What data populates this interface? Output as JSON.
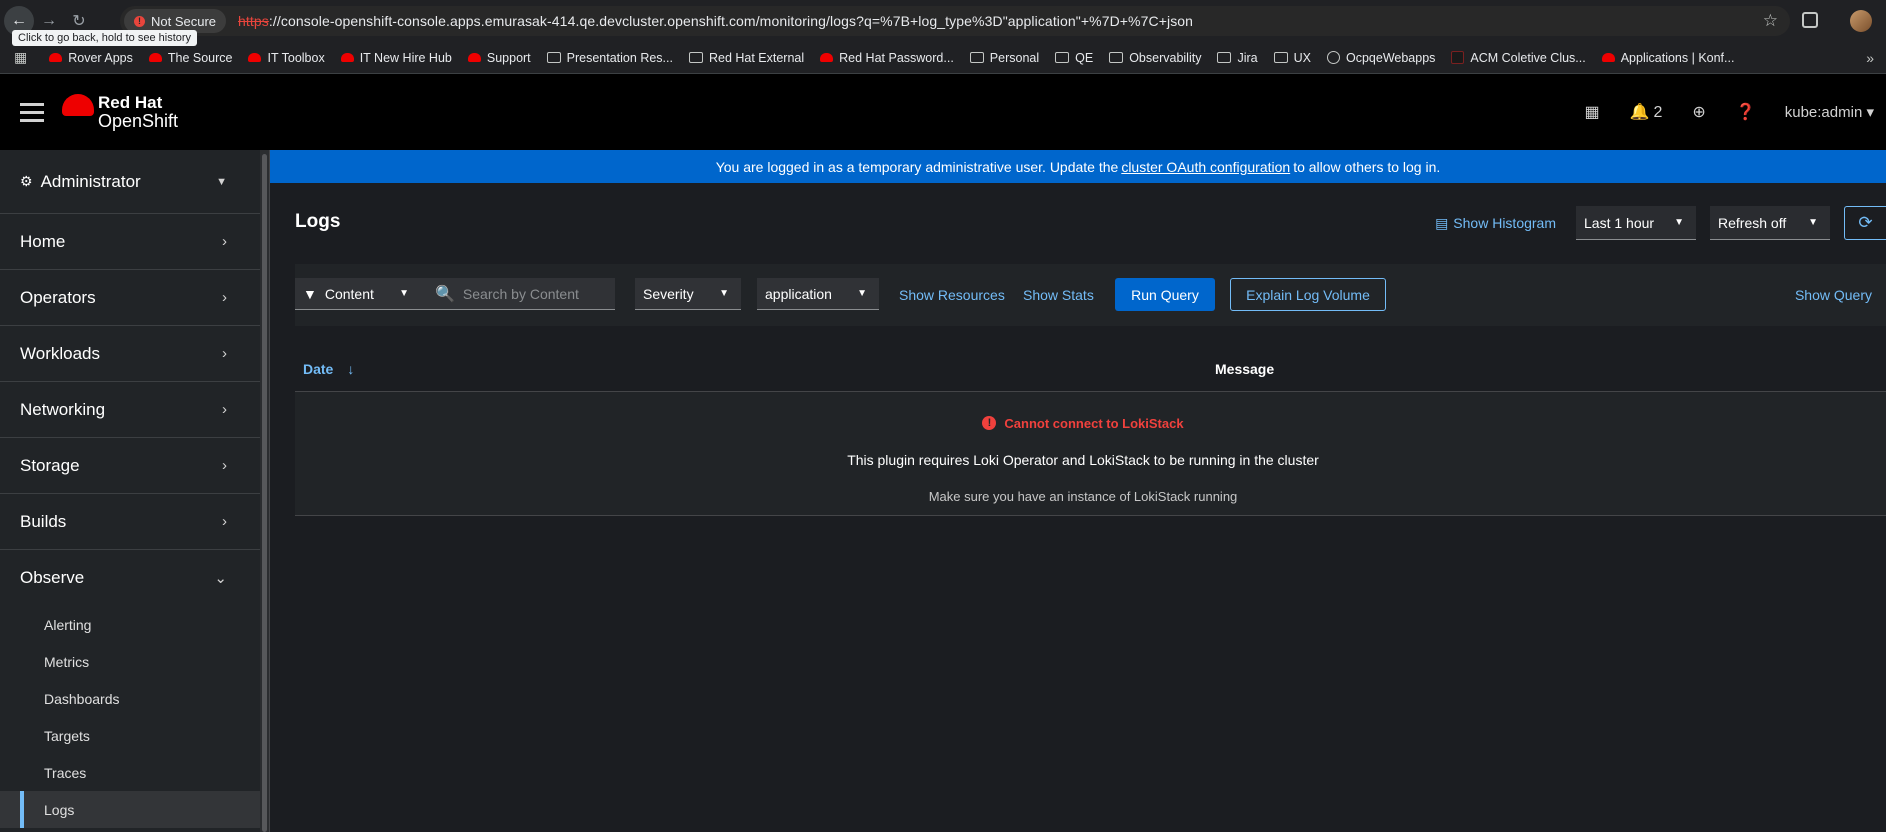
{
  "browser": {
    "not_secure": "Not Secure",
    "url_scheme": "https",
    "url_rest": "://console-openshift-console.apps.emurasak-414.qe.devcluster.openshift.com/monitoring/logs?q=%7B+log_type%3D\"application\"+%7D+%7C+json",
    "tooltip": "Click to go back, hold to see history",
    "bookmarks": [
      {
        "label": "Rover Apps",
        "icon": "redhat"
      },
      {
        "label": "The Source",
        "icon": "redhat"
      },
      {
        "label": "IT Toolbox",
        "icon": "redhat"
      },
      {
        "label": "IT New Hire Hub",
        "icon": "redhat"
      },
      {
        "label": "Support",
        "icon": "redhat"
      },
      {
        "label": "Presentation Res...",
        "icon": "folder"
      },
      {
        "label": "Red Hat External",
        "icon": "folder"
      },
      {
        "label": "Red Hat Password...",
        "icon": "redhat"
      },
      {
        "label": "Personal",
        "icon": "folder"
      },
      {
        "label": "QE",
        "icon": "folder"
      },
      {
        "label": "Observability",
        "icon": "folder"
      },
      {
        "label": "Jira",
        "icon": "folder"
      },
      {
        "label": "UX",
        "icon": "folder"
      },
      {
        "label": "OcpqeWebapps",
        "icon": "globe"
      },
      {
        "label": "ACM Coletive Clus...",
        "icon": "acm"
      },
      {
        "label": "Applications | Konf...",
        "icon": "redhat"
      }
    ]
  },
  "masthead": {
    "logo_line1": "Red Hat",
    "logo_line2": "OpenShift",
    "notifications_count": "2",
    "user": "kube:admin"
  },
  "sidebar": {
    "perspective": "Administrator",
    "sections": [
      "Home",
      "Operators",
      "Workloads",
      "Networking",
      "Storage",
      "Builds"
    ],
    "observe": {
      "label": "Observe",
      "items": [
        "Alerting",
        "Metrics",
        "Dashboards",
        "Targets",
        "Traces",
        "Logs"
      ],
      "active": "Logs"
    }
  },
  "banner": {
    "prefix": "You are logged in as a temporary administrative user. Update the",
    "link": "cluster OAuth configuration",
    "suffix": "to allow others to log in."
  },
  "page": {
    "title": "Logs",
    "show_histogram": "Show Histogram",
    "time_range": "Last 1 hour",
    "refresh": "Refresh off"
  },
  "toolbar": {
    "filter_attribute": "Content",
    "search_placeholder": "Search by Content",
    "severity": "Severity",
    "tenant": "application",
    "show_resources": "Show Resources",
    "show_stats": "Show Stats",
    "run_query": "Run Query",
    "explain_volume": "Explain Log Volume",
    "show_query": "Show Query"
  },
  "table": {
    "col_date": "Date",
    "col_message": "Message",
    "error_title": "Cannot connect to LokiStack",
    "error_body": "This plugin requires Loki Operator and LokiStack to be running in the cluster",
    "error_hint": "Make sure you have an instance of LokiStack running"
  },
  "colors": {
    "accent": "#0066cc",
    "link": "#73bcf7",
    "danger": "#f0413d",
    "brand": "#ee0000"
  }
}
